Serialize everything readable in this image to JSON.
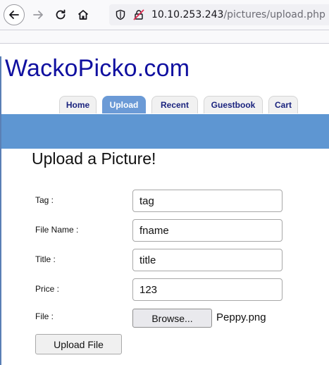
{
  "browser": {
    "url_host": "10.10.253.243",
    "url_path": "/pictures/upload.php"
  },
  "site": {
    "logo": "WackoPicko.com",
    "tabs": [
      {
        "label": "Home",
        "active": false
      },
      {
        "label": "Upload",
        "active": true
      },
      {
        "label": "Recent",
        "active": false
      },
      {
        "label": "Guestbook",
        "active": false
      },
      {
        "label": "Cart",
        "active": false
      }
    ]
  },
  "form": {
    "heading": "Upload a Picture!",
    "tag_label": "Tag :",
    "tag_value": "tag",
    "filename_label": "File Name :",
    "filename_value": "fname",
    "title_label": "Title :",
    "title_value": "title",
    "price_label": "Price :",
    "price_value": "123",
    "file_label": "File :",
    "browse_label": "Browse...",
    "selected_file": "Peppy.png",
    "submit_label": "Upload File"
  },
  "colors": {
    "logo": "#1010a0",
    "tab_active": "#6b9ad6",
    "band": "#5e96d2"
  }
}
